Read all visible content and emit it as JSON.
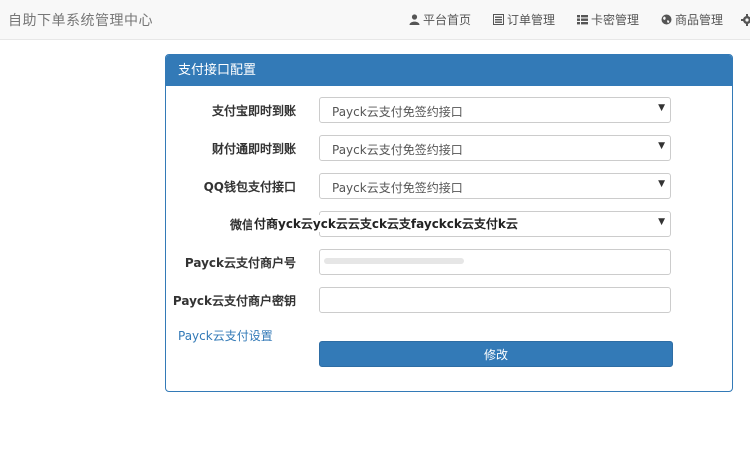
{
  "brand": "自助下单系统管理中心",
  "nav": [
    {
      "icon": "user-icon",
      "label": "平台首页"
    },
    {
      "icon": "list-alt-icon",
      "label": "订单管理"
    },
    {
      "icon": "th-list-icon",
      "label": "卡密管理"
    },
    {
      "icon": "globe-icon",
      "label": "商品管理"
    }
  ],
  "panel": {
    "title": "支付接口配置",
    "alipay": {
      "label": "支付宝即时到账",
      "value": "Payck云支付免签约接口"
    },
    "tenpay": {
      "label": "财付通即时到账",
      "value": "Payck云支付免签约接口"
    },
    "qqpay": {
      "label": "QQ钱包支付接口",
      "value": "Payck云支付免签约接口"
    },
    "wxpay": {
      "label": "微信支",
      "overlay_text": "付商yck云yck云云支ck云支fayckck云支付k云"
    },
    "merchant_id": {
      "label": "Payck云支付商户号",
      "value": ""
    },
    "merchant_key": {
      "label": "Payck云支付商户密钥",
      "value": ""
    },
    "settings_link": "Payck云支付设置",
    "submit_label": "修改"
  }
}
